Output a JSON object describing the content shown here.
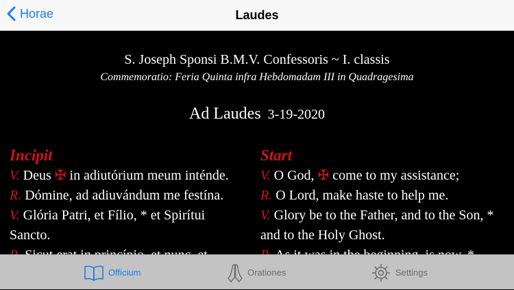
{
  "navbar": {
    "back_label": "Horae",
    "title": "Laudes"
  },
  "header": {
    "feast": "S. Joseph Sponsi B.M.V. Confessoris ~ I. classis",
    "commemoration": "Commemoratio: Feria Quinta infra Hebdomadam III in Quadragesima",
    "hour": "Ad Laudes",
    "date": "3-19-2020"
  },
  "latin": {
    "heading": "Incipit",
    "v1_prefix": "V.",
    "v1_before": "Deus",
    "v1_cross": "✠",
    "v1_after": "in adiutórium meum inténde.",
    "r1_prefix": "R.",
    "r1": "Dómine, ad adiuvándum me festína.",
    "v2_prefix": "V.",
    "v2": "Glória Patri, et Fílio, * et Spirítui Sancto.",
    "r2_prefix": "R.",
    "r2": "Sicut erat in princípio, et nunc, et"
  },
  "english": {
    "heading": "Start",
    "v1_prefix": "V.",
    "v1_before": "O God,",
    "v1_cross": "✠",
    "v1_after": "come to my assistance;",
    "r1_prefix": "R.",
    "r1": "O Lord, make haste to help me.",
    "v2_prefix": "V.",
    "v2": "Glory be to the Father, and to the Son, * and to the Holy Ghost.",
    "r2_prefix": "R.",
    "r2": "As it was in the beginning, is now, *"
  },
  "tabs": {
    "officium": "Officium",
    "orationes": "Orationes",
    "settings": "Settings"
  },
  "colors": {
    "accent": "#1a7cf5",
    "rubric": "#d2121a"
  }
}
